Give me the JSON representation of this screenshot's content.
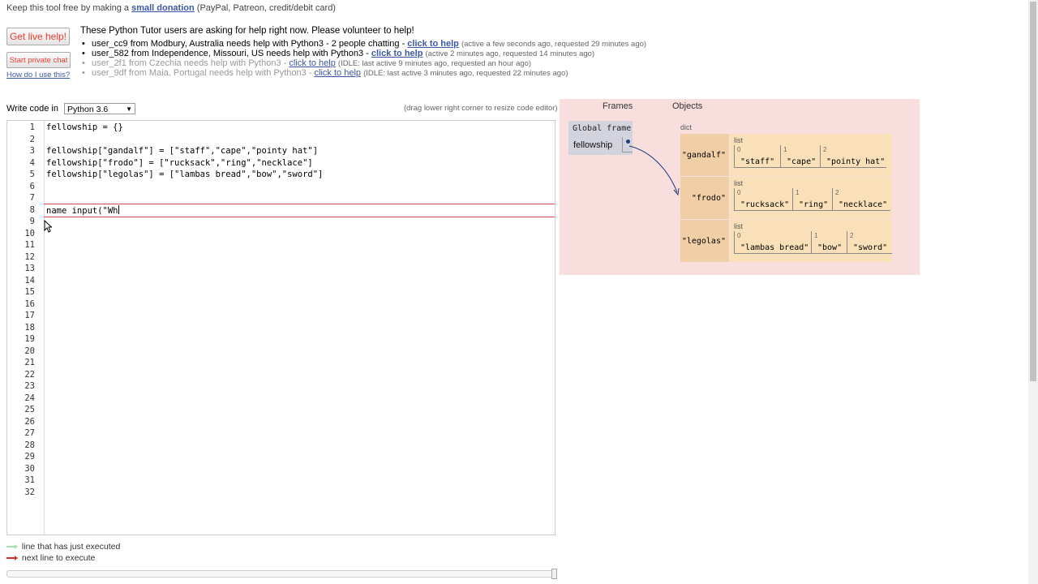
{
  "top": {
    "donate_prefix": "Keep this tool free by making a",
    "donate_link": "small donation",
    "donate_suffix": "(PayPal, Patreon, credit/debit card)"
  },
  "help": {
    "live_button": "Get live help!",
    "private_chat_button": "Start private chat",
    "how_to_link": "How do I use this?",
    "heading": "These Python Tutor users are asking for help right now. Please volunteer to help!",
    "requests": [
      {
        "text": "user_cc9 from Modbury, Australia needs help with Python3 - 2 people chatting -",
        "link": "click to help",
        "meta": "(active a few seconds ago, requested 29 minutes ago)"
      },
      {
        "text": "user_582 from Independence, Missouri, US needs help with Python3 -",
        "link": "click to help",
        "meta": "(active 2 minutes ago, requested 14 minutes ago)"
      },
      {
        "text": "user_2f1 from Czechia needs help with Python3 -",
        "link": "click to help",
        "meta": "(IDLE: last active 9 minutes ago, requested an hour ago)"
      },
      {
        "text": "user_9df from Maia, Portugal needs help with Python3 -",
        "link": "click to help",
        "meta": "(IDLE: last active 3 minutes ago, requested 22 minutes ago)"
      }
    ]
  },
  "editor": {
    "write_code_label": "Write code in",
    "language": "Python 3.6",
    "drag_hint": "(drag lower right corner to resize code editor)",
    "line_numbers": [
      "1",
      "2",
      "3",
      "4",
      "5",
      "6",
      "7",
      "8",
      "9",
      "10",
      "11",
      "12",
      "13",
      "14",
      "15",
      "16",
      "17",
      "18",
      "19",
      "20",
      "21",
      "22",
      "23",
      "24",
      "25",
      "26",
      "27",
      "28",
      "29",
      "30",
      "31",
      "32"
    ],
    "code_lines": [
      "fellowship = {}",
      "",
      "fellowship[\"gandalf\"] = [\"staff\",\"cape\",\"pointy hat\"]",
      "fellowship[\"frodo\"] = [\"rucksack\",\"ring\",\"necklace\"]",
      "fellowship[\"legolas\"] = [\"lambas bread\",\"bow\",\"sword\"]",
      "",
      "",
      "name input(\"Wh"
    ]
  },
  "viz": {
    "frames_label": "Frames",
    "objects_label": "Objects",
    "global_frame_label": "Global frame",
    "global_var": "fellowship",
    "dict_label": "dict",
    "list_label": "list",
    "entries": [
      {
        "key": "\"gandalf\"",
        "items": [
          "\"staff\"",
          "\"cape\"",
          "\"pointy hat\""
        ]
      },
      {
        "key": "\"frodo\"",
        "items": [
          "\"rucksack\"",
          "\"ring\"",
          "\"necklace\""
        ]
      },
      {
        "key": "\"legolas\"",
        "items": [
          "\"lambas bread\"",
          "\"bow\"",
          "\"sword\""
        ]
      }
    ],
    "indices": [
      "0",
      "1",
      "2"
    ]
  },
  "legend": {
    "executed": "line that has just executed",
    "next": "next line to execute",
    "executed_color": "#a6e3a6",
    "next_color": "#d62c2c"
  }
}
